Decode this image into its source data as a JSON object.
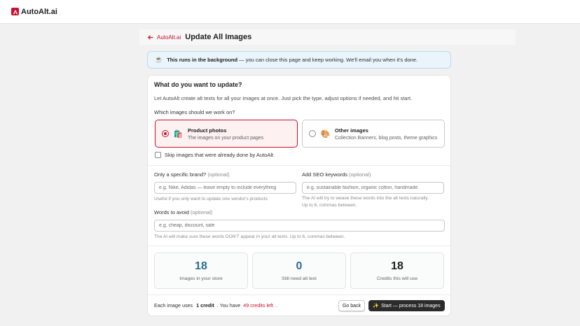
{
  "app": {
    "name": "AutoAlt.ai"
  },
  "header": {
    "back_label": "AutoAlt.ai",
    "title": "Update All Images"
  },
  "banner": {
    "icon": "coffee-icon",
    "bold": "This runs in the background",
    "rest": "— you can close this page and keep working. We'll email you when it's done."
  },
  "form": {
    "title": "What do you want to update?",
    "intro": "Let AutoAlt create alt texts for all your images at once. Just pick the type, adjust options if needed, and hit start.",
    "question": "Which images should we work on?",
    "options": [
      {
        "title": "Product photos",
        "subtitle": "The images on your product pages",
        "selected": true,
        "icon": "shopping-bag-icon"
      },
      {
        "title": "Other images",
        "subtitle": "Collection Banners, blog posts, theme graphics",
        "selected": false,
        "icon": "palette-icon"
      }
    ],
    "skip_label": "Skip images that were already done by AutoAlt",
    "skip_checked": false,
    "brand": {
      "label": "Only a specific brand?",
      "hint": "(optional)",
      "placeholder": "e.g. Nike, Adidas — leave empty to include everything",
      "help": "Useful if you only want to update one vendor's products"
    },
    "seo": {
      "label": "Add SEO keywords",
      "hint": "(optional)",
      "placeholder": "e.g. sustainable fashion, organic cotton, handmade",
      "help1": "The AI will try to weave these words into the alt texts naturally.",
      "help2": "Up to 6, commas between."
    },
    "avoid": {
      "label": "Words to avoid",
      "hint": "(optional)",
      "placeholder": "e.g. cheap, discount, sale",
      "help": "The AI will make sure these words DON'T appear in your alt texts. Up to 6, commas between."
    }
  },
  "stats": [
    {
      "value": "18",
      "label": "Images in your store",
      "color": "#2c6e8e"
    },
    {
      "value": "0",
      "label": "Still need alt text",
      "color": "#2c6e8e"
    },
    {
      "value": "18",
      "label": "Credits this will use",
      "color": "#202020"
    }
  ],
  "footer": {
    "prefix": "Each image uses",
    "credit": "1 credit",
    "middle": ". You have",
    "credits_left": "49 credits left",
    "suffix": ".",
    "back_button": "Go back",
    "start_button": "Start — process 18 images"
  },
  "colors": {
    "brand": "#c8102e",
    "stat_blue": "#2c6e8e",
    "primary_button": "#2b2b2b"
  }
}
